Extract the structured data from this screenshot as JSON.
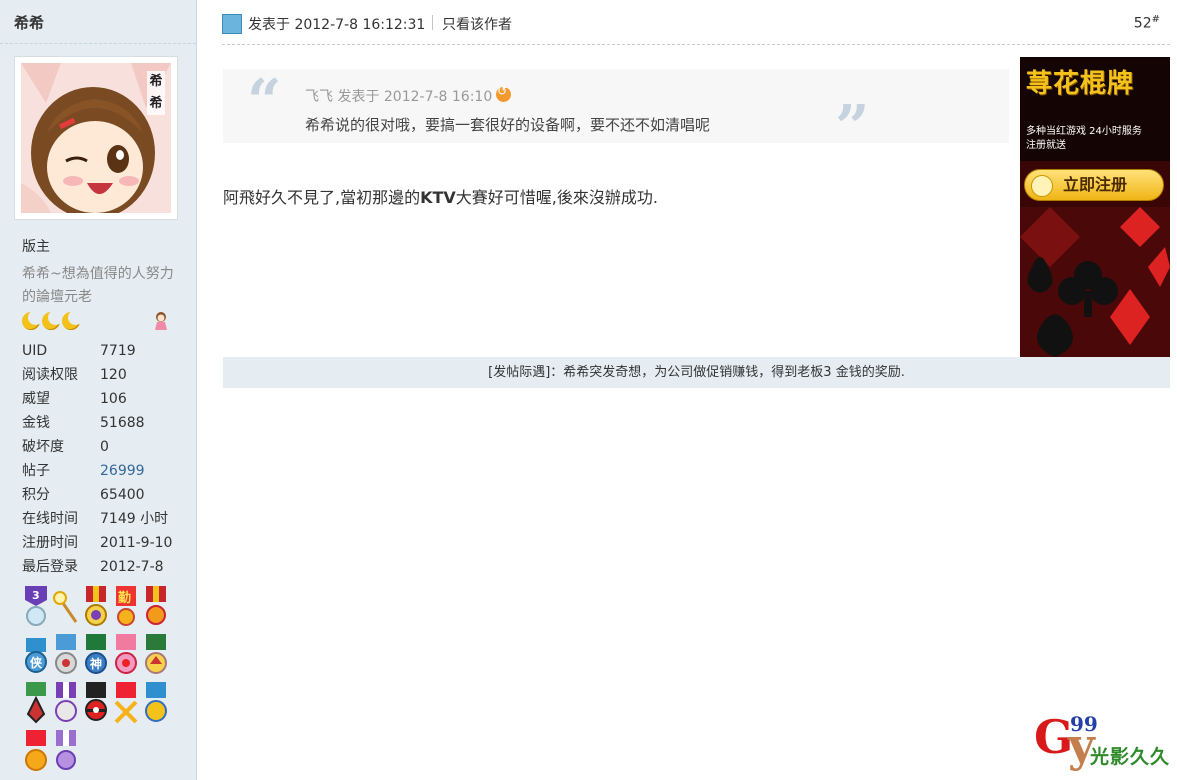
{
  "sidebar": {
    "username": "希希",
    "group": "版主",
    "title": "希希~想為值得的人努力的論壇元老",
    "stats": [
      {
        "label": "UID",
        "value": "7719"
      },
      {
        "label": "阅读权限",
        "value": "120"
      },
      {
        "label": "威望",
        "value": "106"
      },
      {
        "label": "金钱",
        "value": "51688"
      },
      {
        "label": "破坏度",
        "value": "0"
      },
      {
        "label": "帖子",
        "value": "26999"
      },
      {
        "label": "积分",
        "value": "65400"
      },
      {
        "label": "在线时间",
        "value": "7149 小时"
      },
      {
        "label": "注册时间",
        "value": "2011-9-10"
      },
      {
        "label": "最后登录",
        "value": "2012-7-8"
      }
    ],
    "avatar_tag": "希\n希",
    "medal_labels": [
      "3",
      "勤",
      "侠",
      "神"
    ]
  },
  "post": {
    "posted_at": "发表于 2012-7-8 16:12:31",
    "only_author": "只看该作者",
    "floor": "52",
    "floor_mark": "#",
    "quote": {
      "meta": "飞飞 发表于 2012-7-8 16:10",
      "text": "希希说的很对哦，要搞一套很好的设备啊，要不还不如清唱呢"
    },
    "body_pre": "阿飛好久不見了,當初那邊的",
    "body_bold": "KTV",
    "body_post": "大賽好可惜喔,後來沒辦成功.",
    "reward": "[发帖际遇]：希希突发奇想，为公司做促销赚钱，得到老板3 金钱的奖励."
  },
  "ad": {
    "title": "荨花棍牌",
    "subtitle": "多种当红游戏  24小时服务\n注册就送",
    "button": "立即注册"
  },
  "watermark": {
    "g": "G",
    "y": "y",
    "num": "99",
    "text": "光影久久"
  }
}
